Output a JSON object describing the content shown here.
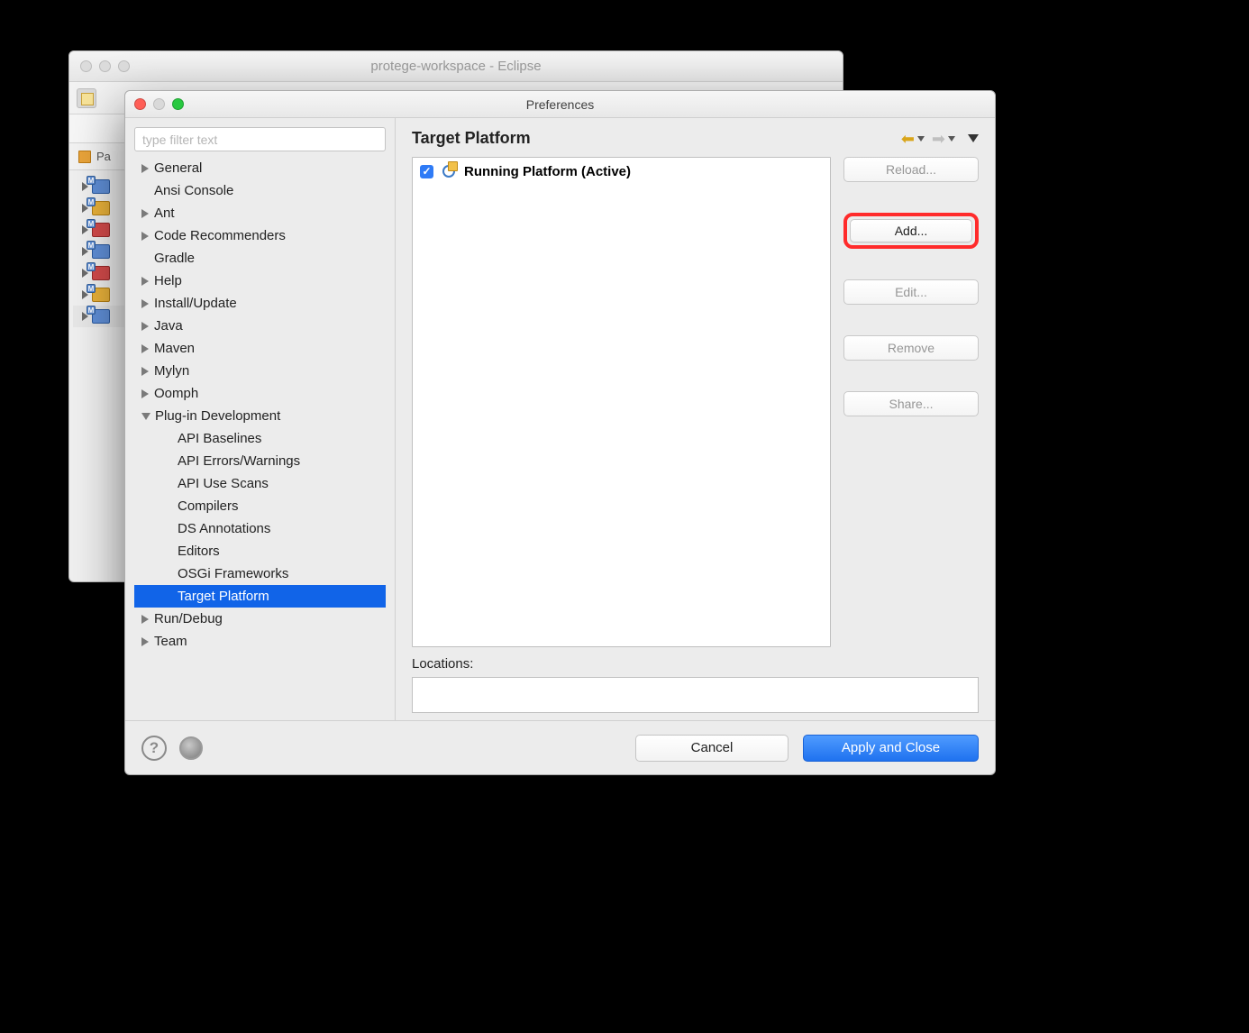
{
  "eclipse_window": {
    "title": "protege-workspace - Eclipse",
    "package_explorer_tab": "Pa"
  },
  "preferences": {
    "title": "Preferences",
    "filter_placeholder": "type filter text",
    "tree": {
      "general": "General",
      "ansi_console": "Ansi Console",
      "ant": "Ant",
      "code_recommenders": "Code Recommenders",
      "gradle": "Gradle",
      "help": "Help",
      "install_update": "Install/Update",
      "java": "Java",
      "maven": "Maven",
      "mylyn": "Mylyn",
      "oomph": "Oomph",
      "plugin_dev": "Plug-in Development",
      "api_baselines": "API Baselines",
      "api_errors": "API Errors/Warnings",
      "api_use_scans": "API Use Scans",
      "compilers": "Compilers",
      "ds_annotations": "DS Annotations",
      "editors": "Editors",
      "osgi_frameworks": "OSGi Frameworks",
      "target_platform": "Target Platform",
      "run_debug": "Run/Debug",
      "team": "Team"
    },
    "page_title": "Target Platform",
    "targets": [
      {
        "checked": true,
        "label": "Running Platform (Active)"
      }
    ],
    "buttons": {
      "reload": "Reload...",
      "add": "Add...",
      "edit": "Edit...",
      "remove": "Remove",
      "share": "Share..."
    },
    "locations_label": "Locations:",
    "footer": {
      "cancel": "Cancel",
      "apply_close": "Apply and Close"
    }
  }
}
